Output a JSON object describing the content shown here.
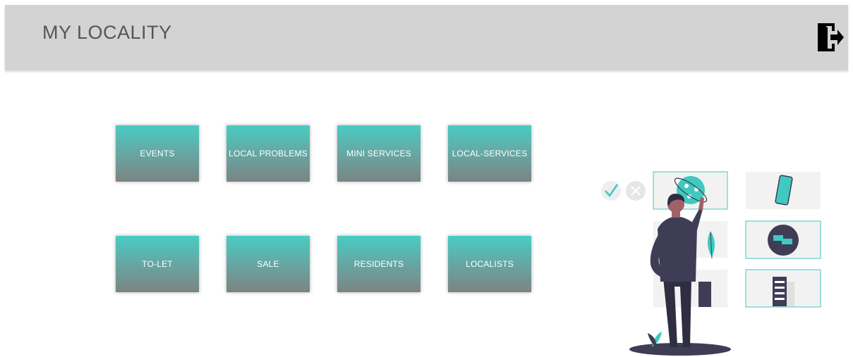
{
  "header": {
    "title": "MY LOCALITY",
    "logout_icon": "logout-door-icon"
  },
  "tiles": [
    {
      "label": "EVENTS"
    },
    {
      "label": "LOCAL PROBLEMS"
    },
    {
      "label": "MINI SERVICES"
    },
    {
      "label": "LOCAL-SERVICES"
    },
    {
      "label": "TO-LET"
    },
    {
      "label": "SALE"
    },
    {
      "label": "RESIDENTS"
    },
    {
      "label": "LOCALISTS"
    }
  ],
  "colors": {
    "header_bg": "#d3d3d3",
    "title_text": "#555555",
    "tile_top": "#48ccc3",
    "tile_bottom": "#7b8484",
    "accent": "#3fc9c0",
    "figure_dark": "#3f3d56"
  },
  "illustration": {
    "icons": [
      "check-icon",
      "cancel-icon",
      "globe-icon",
      "smartphone-icon",
      "chat-icon",
      "building-icon",
      "leaf-icon"
    ]
  }
}
